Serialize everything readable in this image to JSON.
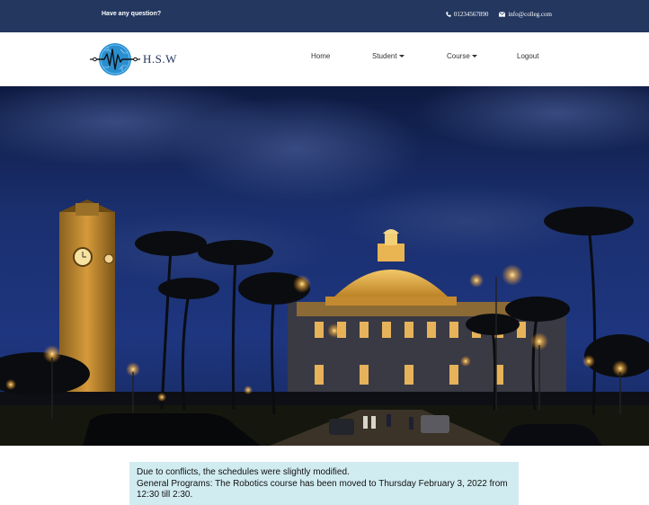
{
  "topbar": {
    "question": "Have any question?",
    "phone": "01234567890",
    "email": "info@colleg.com"
  },
  "brand": {
    "name": "H.S.W"
  },
  "nav": {
    "items": [
      {
        "label": "Home",
        "dropdown": false
      },
      {
        "label": "Student",
        "dropdown": true
      },
      {
        "label": "Course",
        "dropdown": true
      },
      {
        "label": "Logout",
        "dropdown": false
      }
    ]
  },
  "notice": {
    "line1": "Due to conflicts, the schedules were slightly modified.",
    "line2": "General Programs: The Robotics course has been moved to Thursday February 3, 2022 from 12:30 till 2:30."
  },
  "colors": {
    "topbar": "#23375f",
    "notice_bg": "#d1ecf1"
  },
  "hero": {
    "icon": "campus-night-photo"
  }
}
